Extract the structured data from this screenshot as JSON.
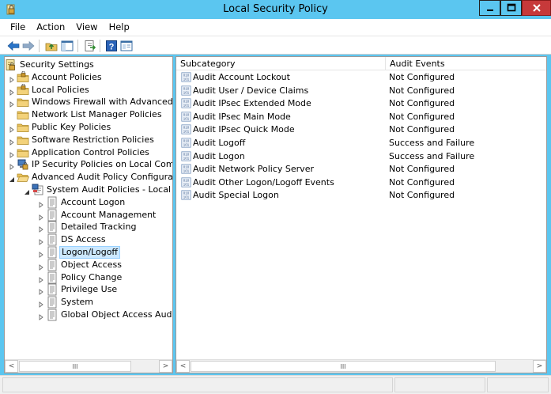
{
  "window": {
    "title": "Local Security Policy",
    "accent": "#5bc6f0",
    "close_color": "#c7393a"
  },
  "menu": [
    "File",
    "Action",
    "View",
    "Help"
  ],
  "toolbar": {
    "buttons": [
      "back-icon",
      "forward-icon",
      "up-folder-icon",
      "show-hide-tree-icon",
      "export-list-icon",
      "help-icon",
      "properties-icon"
    ]
  },
  "tree": {
    "root": "Security Settings",
    "items": [
      {
        "label": "Account Policies",
        "icon": "folder-lock-icon"
      },
      {
        "label": "Local Policies",
        "icon": "folder-lock-icon"
      },
      {
        "label": "Windows Firewall with Advanced Secu",
        "icon": "folder-icon"
      },
      {
        "label": "Network List Manager Policies",
        "icon": "folder-icon"
      },
      {
        "label": "Public Key Policies",
        "icon": "folder-icon"
      },
      {
        "label": "Software Restriction Policies",
        "icon": "folder-icon"
      },
      {
        "label": "Application Control Policies",
        "icon": "folder-icon"
      },
      {
        "label": "IP Security Policies on Local Compute",
        "icon": "ip-security-icon"
      },
      {
        "label": "Advanced Audit Policy Configuration",
        "icon": "folder-open-icon"
      }
    ],
    "sub_root": "System Audit Policies - Local Grou",
    "sub_items": [
      "Account Logon",
      "Account Management",
      "Detailed Tracking",
      "DS Access",
      "Logon/Logoff",
      "Object Access",
      "Policy Change",
      "Privilege Use",
      "System",
      "Global Object Access Auditing"
    ],
    "selected": "Logon/Logoff"
  },
  "list": {
    "headers": [
      "Subcategory",
      "Audit Events"
    ],
    "rows": [
      [
        "Audit Account Lockout",
        "Not Configured"
      ],
      [
        "Audit User / Device Claims",
        "Not Configured"
      ],
      [
        "Audit IPsec Extended Mode",
        "Not Configured"
      ],
      [
        "Audit IPsec Main Mode",
        "Not Configured"
      ],
      [
        "Audit IPsec Quick Mode",
        "Not Configured"
      ],
      [
        "Audit Logoff",
        "Success and Failure"
      ],
      [
        "Audit Logon",
        "Success and Failure"
      ],
      [
        "Audit Network Policy Server",
        "Not Configured"
      ],
      [
        "Audit Other Logon/Logoff Events",
        "Not Configured"
      ],
      [
        "Audit Special Logon",
        "Not Configured"
      ]
    ]
  },
  "scrollbar": {
    "left_arrow": "<",
    "right_arrow": ">",
    "grip": "III"
  }
}
